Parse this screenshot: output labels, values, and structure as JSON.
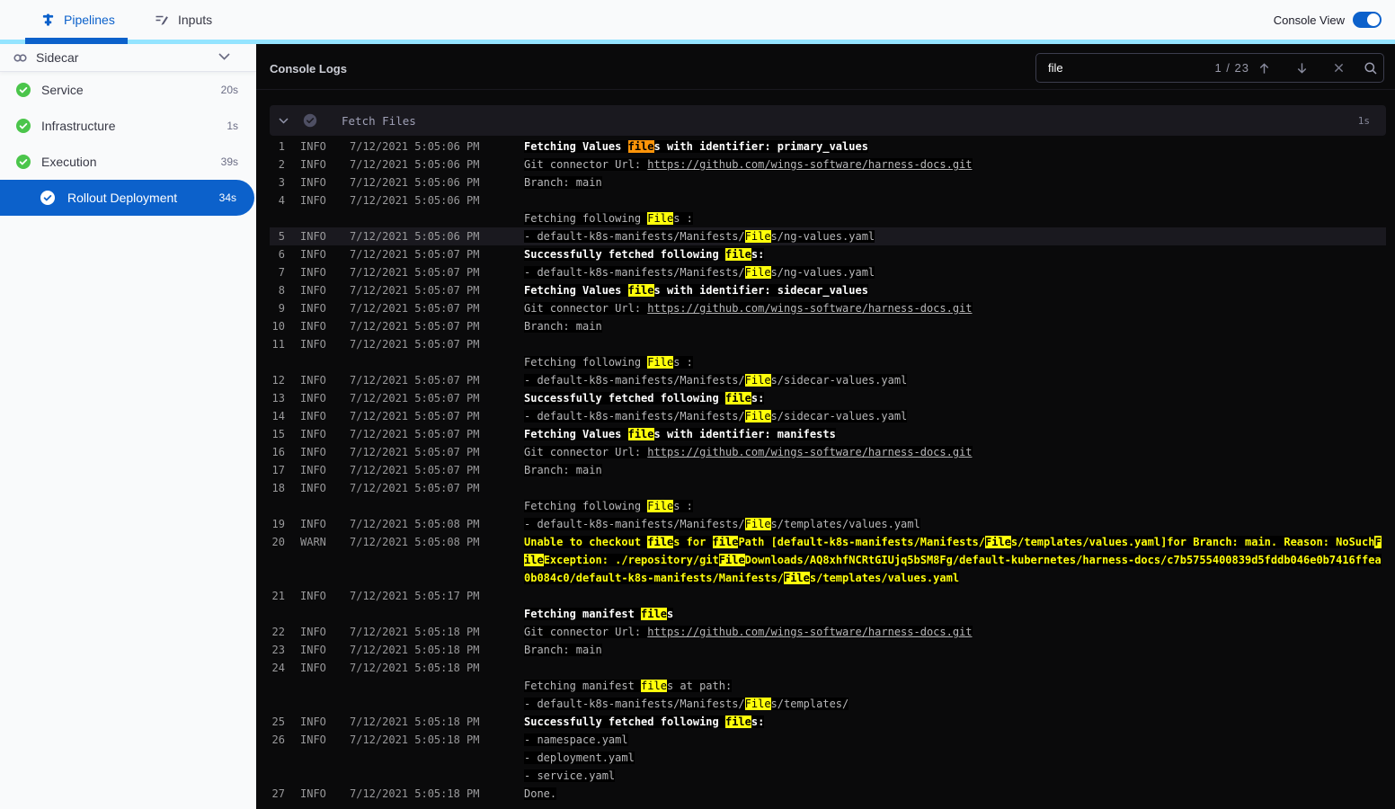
{
  "topbar": {
    "tabs": [
      {
        "label": "Pipelines"
      },
      {
        "label": "Inputs"
      }
    ],
    "console_view_label": "Console View",
    "console_view_on": true
  },
  "sidebar": {
    "title": "Sidecar",
    "stages": [
      {
        "label": "Service",
        "duration": "20s",
        "status": "success"
      },
      {
        "label": "Infrastructure",
        "duration": "1s",
        "status": "success"
      },
      {
        "label": "Execution",
        "duration": "39s",
        "status": "success"
      }
    ],
    "selected_step": {
      "label": "Rollout Deployment",
      "duration": "34s",
      "status": "success"
    }
  },
  "console": {
    "title": "Console Logs",
    "search": {
      "value": "file",
      "count_label": "1 / 23",
      "current_match": 1
    },
    "section": {
      "title": "Fetch Files",
      "duration": "1s"
    },
    "highlight_term": "file",
    "logs": [
      {
        "n": "1",
        "level": "INFO",
        "time": "7/12/2021 5:05:06 PM",
        "lines": [
          {
            "text": "Fetching Values files with identifier: primary_values",
            "bold": true
          }
        ]
      },
      {
        "n": "2",
        "level": "INFO",
        "time": "7/12/2021 5:05:06 PM",
        "lines": [
          {
            "text": "Git connector Url: ",
            "link": "https://github.com/wings-software/harness-docs.git"
          }
        ]
      },
      {
        "n": "3",
        "level": "INFO",
        "time": "7/12/2021 5:05:06 PM",
        "lines": [
          {
            "text": "Branch: main"
          }
        ]
      },
      {
        "n": "4",
        "level": "INFO",
        "time": "7/12/2021 5:05:06 PM",
        "lines": [
          {
            "text": ""
          },
          {
            "text": "Fetching following Files :"
          }
        ]
      },
      {
        "n": "5",
        "level": "INFO",
        "time": "7/12/2021 5:05:06 PM",
        "highlight_row": true,
        "lines": [
          {
            "text": "- default-k8s-manifests/Manifests/Files/ng-values.yaml"
          }
        ]
      },
      {
        "n": "6",
        "level": "INFO",
        "time": "7/12/2021 5:05:07 PM",
        "lines": [
          {
            "text": "Successfully fetched following files:",
            "bold": true
          }
        ]
      },
      {
        "n": "7",
        "level": "INFO",
        "time": "7/12/2021 5:05:07 PM",
        "lines": [
          {
            "text": "- default-k8s-manifests/Manifests/Files/ng-values.yaml"
          }
        ]
      },
      {
        "n": "8",
        "level": "INFO",
        "time": "7/12/2021 5:05:07 PM",
        "lines": [
          {
            "text": "Fetching Values files with identifier: sidecar_values",
            "bold": true
          }
        ]
      },
      {
        "n": "9",
        "level": "INFO",
        "time": "7/12/2021 5:05:07 PM",
        "lines": [
          {
            "text": "Git connector Url: ",
            "link": "https://github.com/wings-software/harness-docs.git"
          }
        ]
      },
      {
        "n": "10",
        "level": "INFO",
        "time": "7/12/2021 5:05:07 PM",
        "lines": [
          {
            "text": "Branch: main"
          }
        ]
      },
      {
        "n": "11",
        "level": "INFO",
        "time": "7/12/2021 5:05:07 PM",
        "lines": [
          {
            "text": ""
          },
          {
            "text": "Fetching following Files :"
          }
        ]
      },
      {
        "n": "12",
        "level": "INFO",
        "time": "7/12/2021 5:05:07 PM",
        "lines": [
          {
            "text": "- default-k8s-manifests/Manifests/Files/sidecar-values.yaml"
          }
        ]
      },
      {
        "n": "13",
        "level": "INFO",
        "time": "7/12/2021 5:05:07 PM",
        "lines": [
          {
            "text": "Successfully fetched following files:",
            "bold": true
          }
        ]
      },
      {
        "n": "14",
        "level": "INFO",
        "time": "7/12/2021 5:05:07 PM",
        "lines": [
          {
            "text": "- default-k8s-manifests/Manifests/Files/sidecar-values.yaml"
          }
        ]
      },
      {
        "n": "15",
        "level": "INFO",
        "time": "7/12/2021 5:05:07 PM",
        "lines": [
          {
            "text": "Fetching Values files with identifier: manifests",
            "bold": true
          }
        ]
      },
      {
        "n": "16",
        "level": "INFO",
        "time": "7/12/2021 5:05:07 PM",
        "lines": [
          {
            "text": "Git connector Url: ",
            "link": "https://github.com/wings-software/harness-docs.git"
          }
        ]
      },
      {
        "n": "17",
        "level": "INFO",
        "time": "7/12/2021 5:05:07 PM",
        "lines": [
          {
            "text": "Branch: main"
          }
        ]
      },
      {
        "n": "18",
        "level": "INFO",
        "time": "7/12/2021 5:05:07 PM",
        "lines": [
          {
            "text": ""
          },
          {
            "text": "Fetching following Files :"
          }
        ]
      },
      {
        "n": "19",
        "level": "INFO",
        "time": "7/12/2021 5:05:08 PM",
        "lines": [
          {
            "text": "- default-k8s-manifests/Manifests/Files/templates/values.yaml"
          }
        ]
      },
      {
        "n": "20",
        "level": "WARN",
        "time": "7/12/2021 5:05:08 PM",
        "lines": [
          {
            "text": "Unable to checkout files for filePath [default-k8s-manifests/Manifests/Files/templates/values.yaml]for Branch: main. Reason: NoSuchFileException: ./repository/gitFileDownloads/AQ8xhfNCRtGIUjq5bSM8Fg/default-kubernetes/harness-docs/c7b5755400839d5fddb046e0b7416ffea0b084c0/default-k8s-manifests/Manifests/Files/templates/values.yaml",
            "bold": true,
            "warn": true
          }
        ]
      },
      {
        "n": "21",
        "level": "INFO",
        "time": "7/12/2021 5:05:17 PM",
        "lines": [
          {
            "text": ""
          },
          {
            "text": "Fetching manifest files",
            "bold": true
          }
        ]
      },
      {
        "n": "22",
        "level": "INFO",
        "time": "7/12/2021 5:05:18 PM",
        "lines": [
          {
            "text": "Git connector Url: ",
            "link": "https://github.com/wings-software/harness-docs.git"
          }
        ]
      },
      {
        "n": "23",
        "level": "INFO",
        "time": "7/12/2021 5:05:18 PM",
        "lines": [
          {
            "text": "Branch: main"
          }
        ]
      },
      {
        "n": "24",
        "level": "INFO",
        "time": "7/12/2021 5:05:18 PM",
        "lines": [
          {
            "text": ""
          },
          {
            "text": "Fetching manifest files at path:"
          },
          {
            "text": "- default-k8s-manifests/Manifests/Files/templates/"
          }
        ]
      },
      {
        "n": "25",
        "level": "INFO",
        "time": "7/12/2021 5:05:18 PM",
        "lines": [
          {
            "text": "Successfully fetched following files:",
            "bold": true
          }
        ]
      },
      {
        "n": "26",
        "level": "INFO",
        "time": "7/12/2021 5:05:18 PM",
        "lines": [
          {
            "text": "- namespace.yaml"
          },
          {
            "text": "- deployment.yaml"
          },
          {
            "text": "- service.yaml"
          }
        ]
      },
      {
        "n": "27",
        "level": "INFO",
        "time": "7/12/2021 5:05:18 PM",
        "lines": [
          {
            "text": "Done."
          }
        ]
      }
    ]
  }
}
